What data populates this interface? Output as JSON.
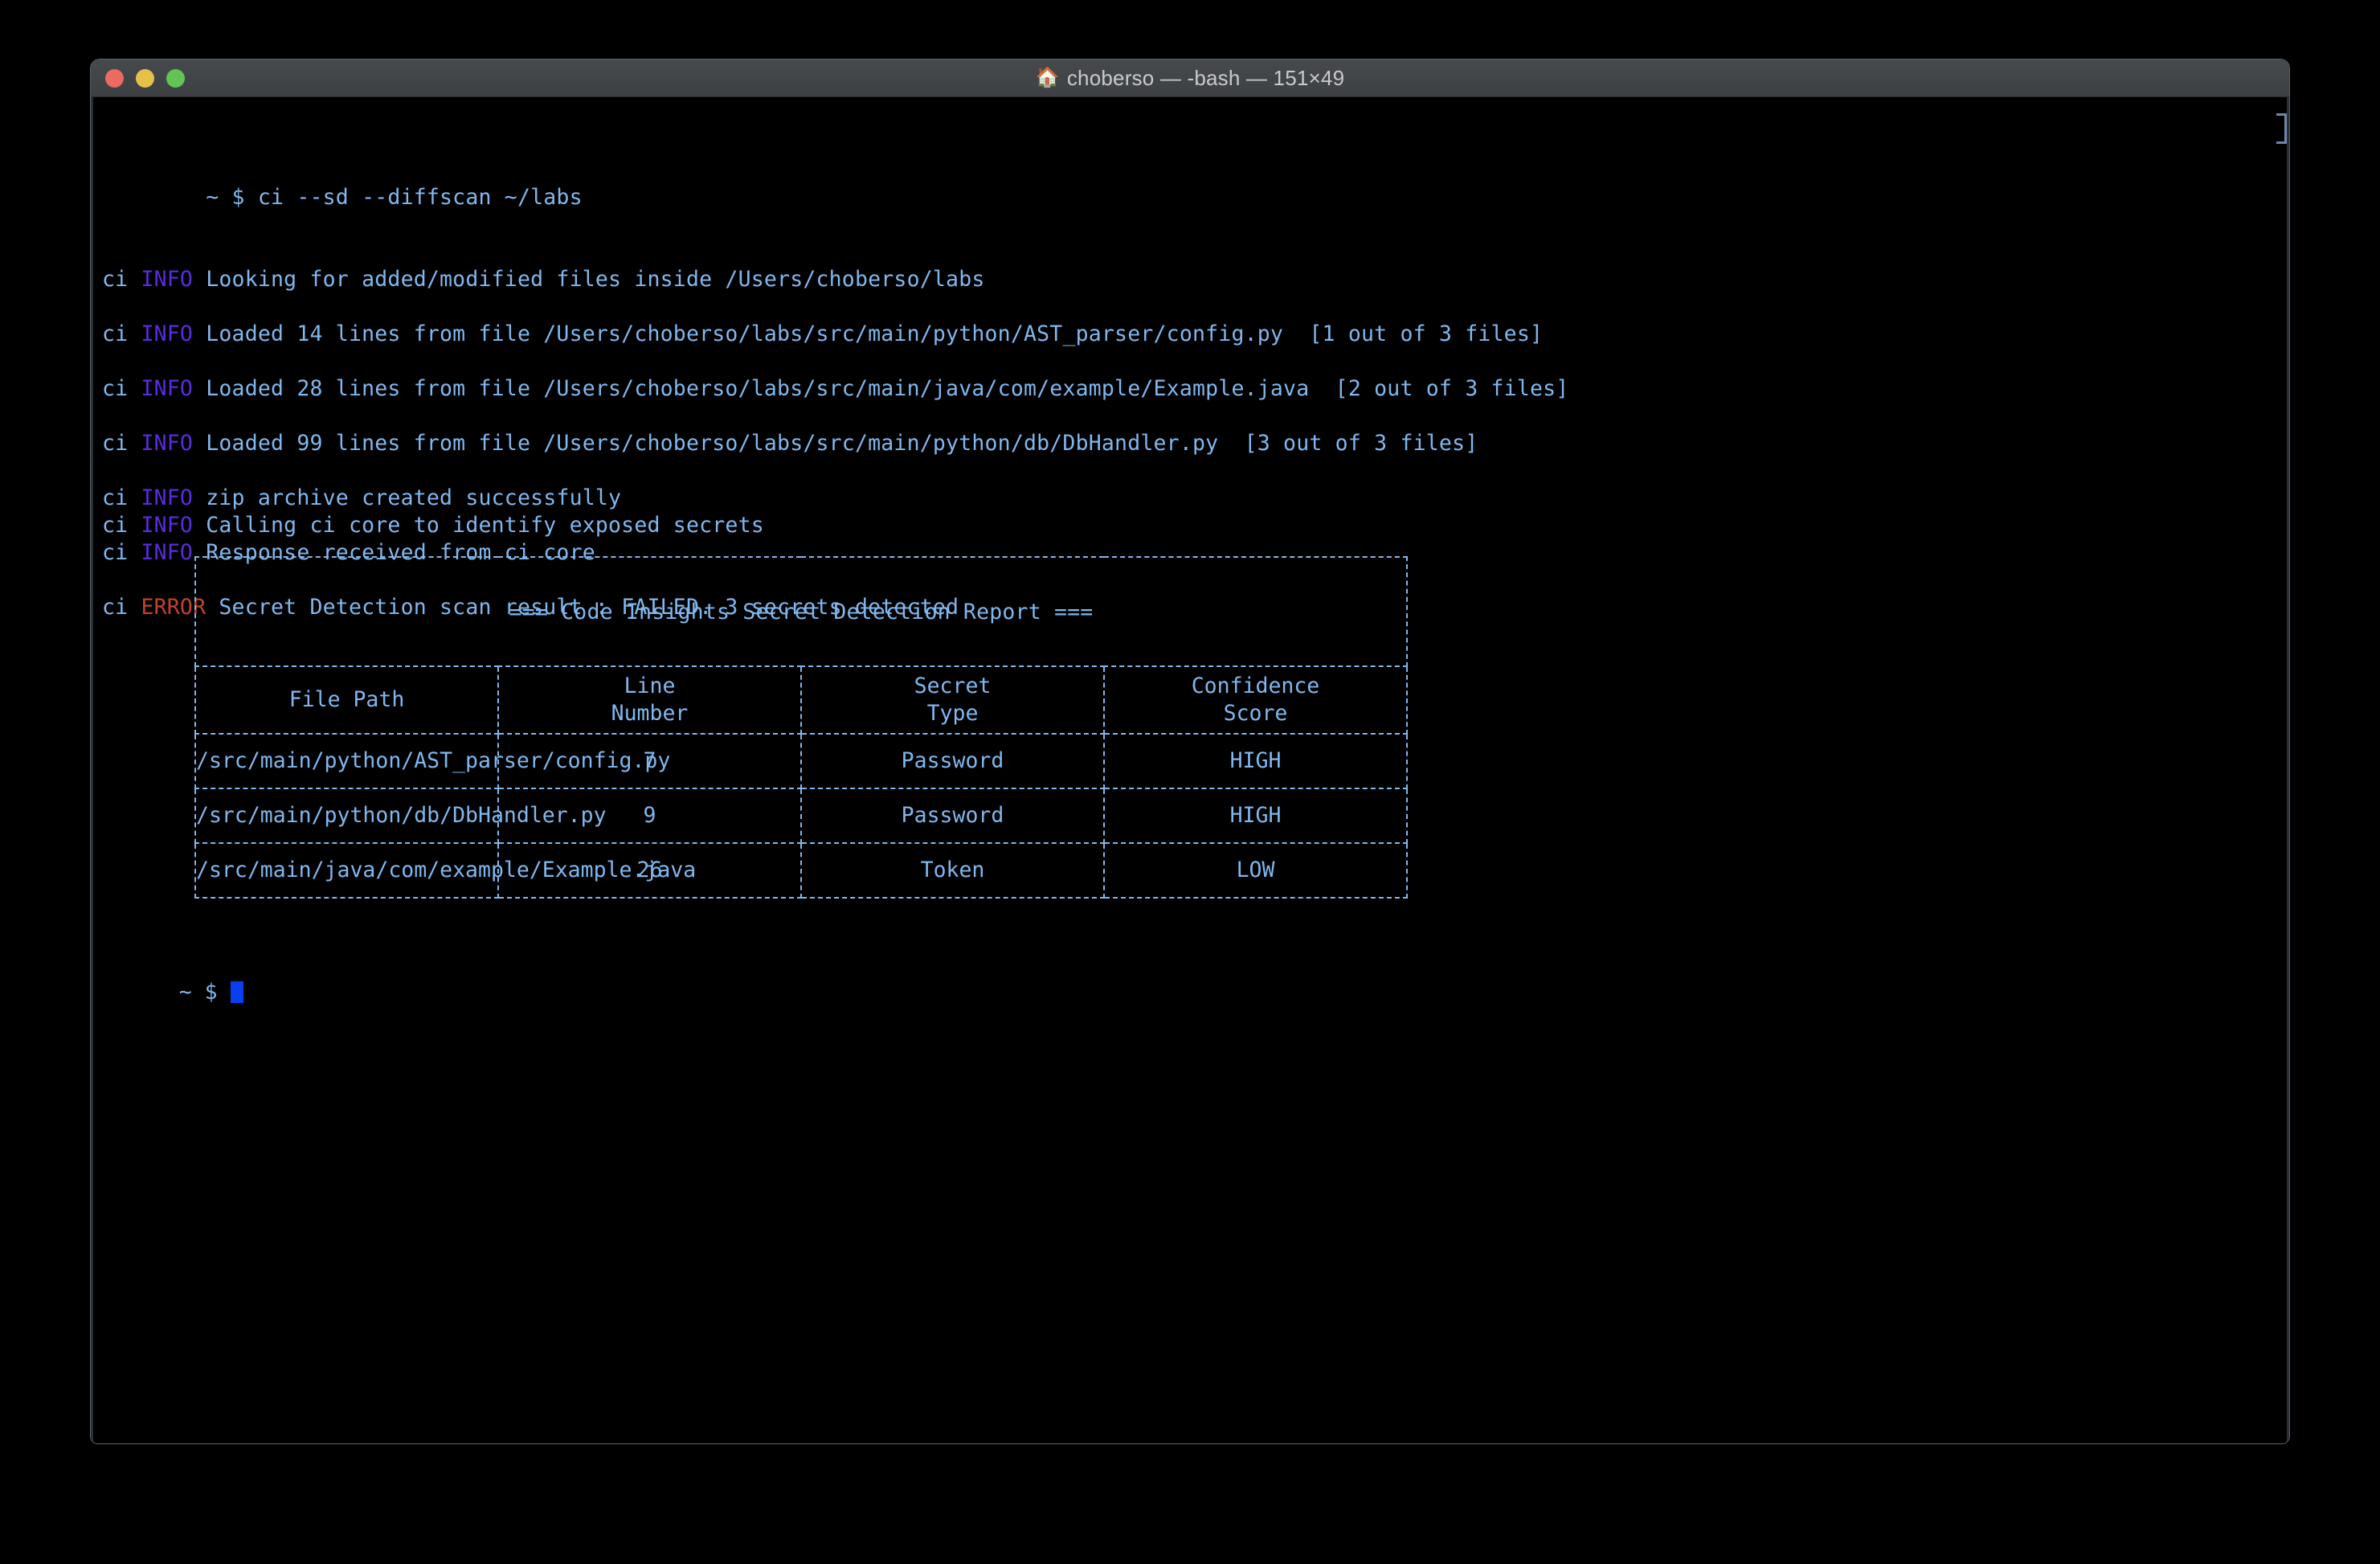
{
  "window": {
    "title": "choberso — -bash — 151×49",
    "title_icon": "house-icon",
    "icon_glyph": "🏠",
    "traffic_lights": {
      "close": "close-button",
      "minimize": "minimize-button",
      "maximize": "maximize-button"
    },
    "colors": {
      "background": "#000000",
      "text": "#7fb8ee",
      "info": "#5b2be0",
      "error": "#c4422b",
      "cursor": "#0a3ff0",
      "titlebar": "#3f4245",
      "title_text": "#c8cacc",
      "close": "#ec6a5f",
      "minimize": "#e5c148",
      "maximize": "#62c454"
    }
  },
  "console": {
    "prompt_line": "~ $ ci --sd --diffscan ~/labs",
    "lines": [
      {
        "type": "blank"
      },
      {
        "type": "log",
        "app": "ci ",
        "level": "INFO",
        "level_kind": "info",
        "message": " Looking for added/modified files inside /Users/choberso/labs"
      },
      {
        "type": "blank"
      },
      {
        "type": "log",
        "app": "ci ",
        "level": "INFO",
        "level_kind": "info",
        "message": " Loaded 14 lines from file /Users/choberso/labs/src/main/python/AST_parser/config.py  [1 out of 3 files]"
      },
      {
        "type": "blank"
      },
      {
        "type": "log",
        "app": "ci ",
        "level": "INFO",
        "level_kind": "info",
        "message": " Loaded 28 lines from file /Users/choberso/labs/src/main/java/com/example/Example.java  [2 out of 3 files]"
      },
      {
        "type": "blank"
      },
      {
        "type": "log",
        "app": "ci ",
        "level": "INFO",
        "level_kind": "info",
        "message": " Loaded 99 lines from file /Users/choberso/labs/src/main/python/db/DbHandler.py  [3 out of 3 files]"
      },
      {
        "type": "blank"
      },
      {
        "type": "log",
        "app": "ci ",
        "level": "INFO",
        "level_kind": "info",
        "message": " zip archive created successfully"
      },
      {
        "type": "log",
        "app": "ci ",
        "level": "INFO",
        "level_kind": "info",
        "message": " Calling ci core to identify exposed secrets"
      },
      {
        "type": "log",
        "app": "ci ",
        "level": "INFO",
        "level_kind": "info",
        "message": " Response received from ci core"
      },
      {
        "type": "blank"
      },
      {
        "type": "log",
        "app": "ci ",
        "level": "ERROR",
        "level_kind": "error",
        "message": " Secret Detection scan result : FAILED. 3 secrets detected"
      }
    ],
    "final_prompt": "~ $ "
  },
  "report": {
    "title": "=== Code Insights Secret Detection Report ===",
    "headers": {
      "file_path": "File Path",
      "line_number": "Line\nNumber",
      "secret_type": "Secret\nType",
      "confidence_score": "Confidence\nScore"
    },
    "rows": [
      {
        "file_path": "/src/main/python/AST_parser/config.py",
        "line_number": "7",
        "secret_type": "Password",
        "confidence_score": "HIGH"
      },
      {
        "file_path": "/src/main/python/db/DbHandler.py",
        "line_number": "9",
        "secret_type": "Password",
        "confidence_score": "HIGH"
      },
      {
        "file_path": "/src/main/java/com/example/Example.java",
        "line_number": "26",
        "secret_type": "Token",
        "confidence_score": "LOW"
      }
    ]
  }
}
